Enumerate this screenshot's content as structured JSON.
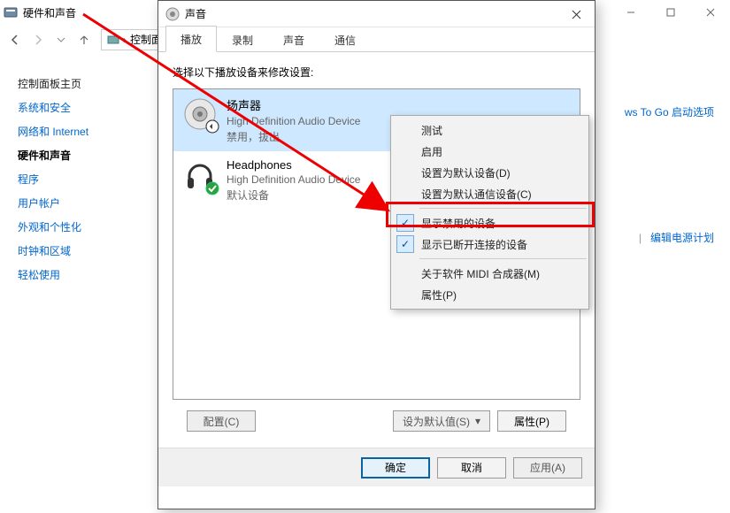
{
  "bg": {
    "title": "硬件和声音",
    "breadcrumb_item": "控制面",
    "sidebar_heading": "控制面板主页",
    "sidebar_items": [
      {
        "label": "系统和安全"
      },
      {
        "label": "网络和 Internet"
      },
      {
        "label": "硬件和声音"
      },
      {
        "label": "程序"
      },
      {
        "label": "用户帐户"
      },
      {
        "label": "外观和个性化"
      },
      {
        "label": "时钟和区域"
      },
      {
        "label": "轻松使用"
      }
    ],
    "right_links": {
      "top": "ws To Go 启动选项",
      "row2_pipe": "|",
      "row2_b": "编辑电源计划"
    }
  },
  "dlg": {
    "title": "声音",
    "tabs": [
      {
        "label": "播放"
      },
      {
        "label": "录制"
      },
      {
        "label": "声音"
      },
      {
        "label": "通信"
      }
    ],
    "instruction": "选择以下播放设备来修改设置:",
    "devices": [
      {
        "name": "扬声器",
        "desc": "High Definition Audio Device",
        "status": "禁用，拔出"
      },
      {
        "name": "Headphones",
        "desc": "High Definition Audio Device",
        "status": "默认设备"
      }
    ],
    "buttons": {
      "config": "配置(C)",
      "setdefault": "设为默认值(S)",
      "props": "属性(P)",
      "ok": "确定",
      "cancel": "取消",
      "apply": "应用(A)"
    }
  },
  "ctx": {
    "items": [
      {
        "label": "测试"
      },
      {
        "label": "启用"
      },
      {
        "label": "设置为默认设备(D)"
      },
      {
        "label": "设置为默认通信设备(C)"
      },
      {
        "label": "显示禁用的设备",
        "checked": true
      },
      {
        "label": "显示已断开连接的设备",
        "checked": true
      },
      {
        "label": "关于软件 MIDI 合成器(M)"
      },
      {
        "label": "属性(P)"
      }
    ]
  }
}
